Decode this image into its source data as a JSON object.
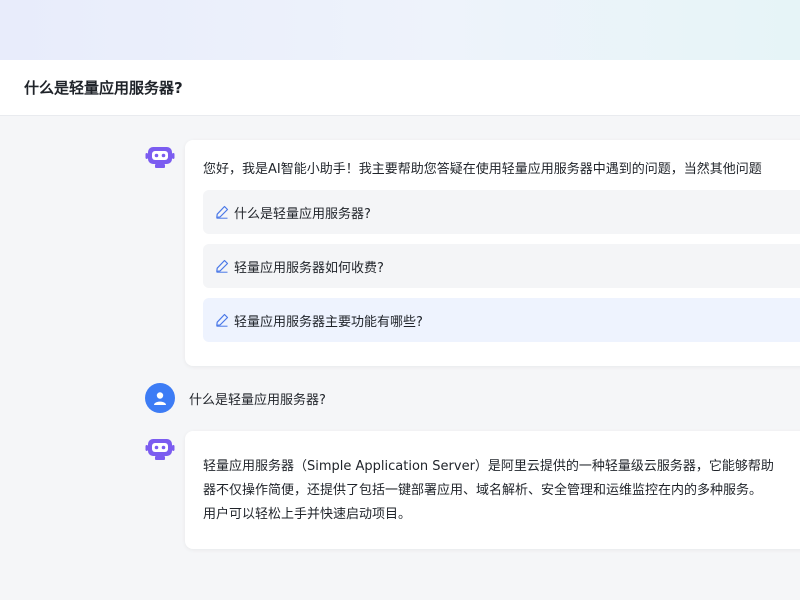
{
  "header": {
    "title": "什么是轻量应用服务器?"
  },
  "welcome": {
    "text": "您好，我是AI智能小助手！我主要帮助您答疑在使用轻量应用服务器中遇到的问题，当然其他问题",
    "suggestions": [
      {
        "label": "什么是轻量应用服务器?"
      },
      {
        "label": "轻量应用服务器如何收费?"
      },
      {
        "label": "轻量应用服务器主要功能有哪些?"
      }
    ]
  },
  "user_message": {
    "text": "什么是轻量应用服务器?"
  },
  "answer": {
    "lines": [
      "轻量应用服务器（Simple Application Server）是阿里云提供的一种轻量级云服务器，它能够帮助",
      "器不仅操作简便，还提供了包括一键部署应用、域名解析、安全管理和运维监控在内的多种服务。",
      "用户可以轻松上手并快速启动项目。"
    ]
  },
  "colors": {
    "bot_avatar": "#7b5cf0",
    "user_avatar": "#3d7cf5",
    "suggestion_bg": "#f4f5f7",
    "suggestion_active_bg": "#eef3fe",
    "pen_icon": "#4a78e8"
  },
  "icons": {
    "bot": "robot-icon",
    "user": "user-icon",
    "suggestion": "pen-icon"
  }
}
